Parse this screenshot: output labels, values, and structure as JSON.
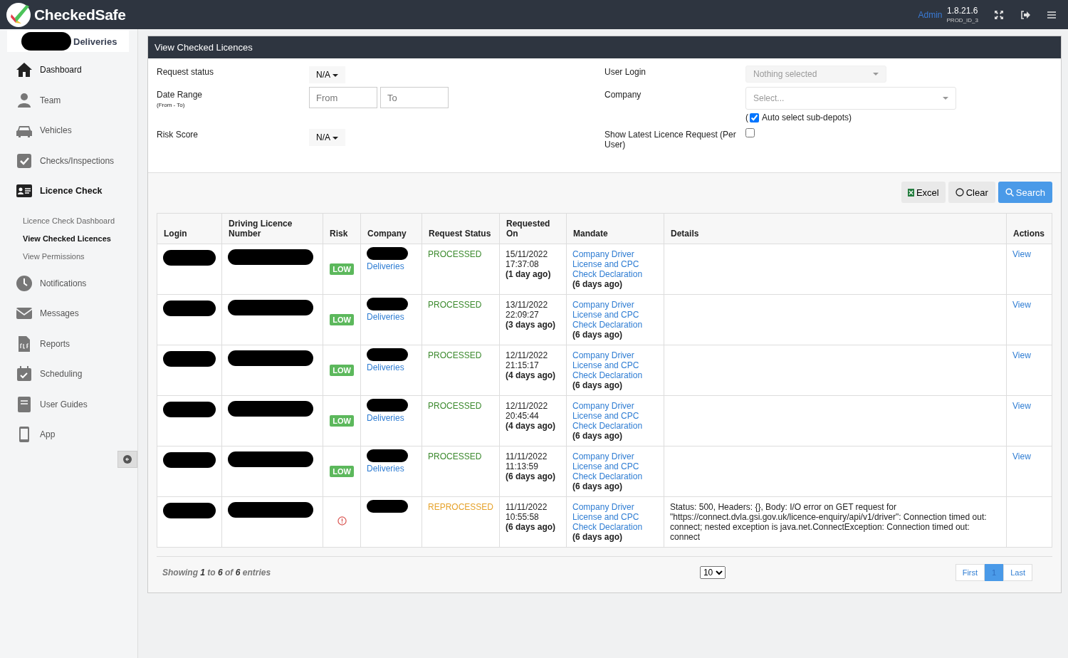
{
  "header": {
    "brand": "CheckedSafe",
    "role": "Admin",
    "version": "1.8.21.6",
    "env": "PROD_ID_3"
  },
  "sidebar": {
    "company": "Deliveries",
    "items": [
      {
        "label": "Dashboard",
        "selected": false
      },
      {
        "label": "Team",
        "selected": false
      },
      {
        "label": "Vehicles",
        "selected": false
      },
      {
        "label": "Checks/Inspections",
        "selected": false
      },
      {
        "label": "Licence Check",
        "selected": true,
        "children": [
          {
            "label": "Licence Check Dashboard",
            "selected": false
          },
          {
            "label": "View Checked Licences",
            "selected": true
          },
          {
            "label": "View Permissions",
            "selected": false
          }
        ]
      },
      {
        "label": "Notifications",
        "selected": false
      },
      {
        "label": "Messages",
        "selected": false
      },
      {
        "label": "Reports",
        "selected": false
      },
      {
        "label": "Scheduling",
        "selected": false
      },
      {
        "label": "User Guides",
        "selected": false
      },
      {
        "label": "App",
        "selected": false
      }
    ]
  },
  "panel": {
    "title": "View Checked Licences",
    "filters": {
      "request_status": {
        "label": "Request status",
        "value": "N/A"
      },
      "date_range": {
        "label": "Date Range",
        "hint": "(From - To)",
        "from_placeholder": "From",
        "to_placeholder": "To"
      },
      "risk_score": {
        "label": "Risk Score",
        "value": "N/A"
      },
      "user_login": {
        "label": "User Login",
        "placeholder": "Nothing selected"
      },
      "company": {
        "label": "Company",
        "placeholder": "Select...",
        "paren": "(",
        "auto_select": {
          "label": "Auto select sub-depots)",
          "checked": true
        }
      },
      "show_latest": {
        "label": "Show Latest Licence Request (Per User)",
        "checked": false
      }
    },
    "buttons": [
      {
        "label": "Excel",
        "kind": "excel"
      },
      {
        "label": "Clear",
        "kind": "clear"
      },
      {
        "label": "Search",
        "kind": "search"
      }
    ],
    "table": {
      "columns": [
        "Login",
        "Driving Licence Number",
        "Risk",
        "Company",
        "Request Status",
        "Requested On",
        "Mandate",
        "Details",
        "Actions"
      ],
      "rows": [
        {
          "risk": {
            "kind": "badge",
            "label": "LOW"
          },
          "company": "Deliveries",
          "status": {
            "kind": "processed",
            "label": "PROCESSED"
          },
          "date": "15/11/2022",
          "time": "17:37:08",
          "ago": "(1 day ago)",
          "mandate": "Company Driver License and CPC Check Declaration",
          "mandate_ago": "(6 days ago)",
          "action": "View"
        },
        {
          "risk": {
            "kind": "badge",
            "label": "LOW"
          },
          "company": "Deliveries",
          "status": {
            "kind": "processed",
            "label": "PROCESSED"
          },
          "date": "13/11/2022",
          "time": "22:09:27",
          "ago": "(3 days ago)",
          "mandate": "Company Driver License and CPC Check Declaration",
          "mandate_ago": "(6 days ago)",
          "action": "View"
        },
        {
          "risk": {
            "kind": "badge",
            "label": "LOW"
          },
          "company": "Deliveries",
          "status": {
            "kind": "processed",
            "label": "PROCESSED"
          },
          "date": "12/11/2022",
          "time": "21:15:17",
          "ago": "(4 days ago)",
          "mandate": "Company Driver License and CPC Check Declaration",
          "mandate_ago": "(6 days ago)",
          "action": "View"
        },
        {
          "risk": {
            "kind": "badge",
            "label": "LOW"
          },
          "company": "Deliveries",
          "status": {
            "kind": "processed",
            "label": "PROCESSED"
          },
          "date": "12/11/2022",
          "time": "20:45:44",
          "ago": "(4 days ago)",
          "mandate": "Company Driver License and CPC Check Declaration",
          "mandate_ago": "(6 days ago)",
          "action": "View"
        },
        {
          "risk": {
            "kind": "badge",
            "label": "LOW"
          },
          "company": "Deliveries",
          "status": {
            "kind": "processed",
            "label": "PROCESSED"
          },
          "date": "11/11/2022",
          "time": "11:13:59",
          "ago": "(6 days ago)",
          "mandate": "Company Driver License and CPC Check Declaration",
          "mandate_ago": "(6 days ago)",
          "action": "View"
        },
        {
          "risk": {
            "kind": "error"
          },
          "status": {
            "kind": "reprocessed",
            "label": "REPROCESSED"
          },
          "date": "11/11/2022",
          "time": "10:55:58",
          "ago": "(6 days ago)",
          "mandate": "Company Driver License and CPC Check Declaration",
          "mandate_ago": "(6 days ago)",
          "details": "Status: 500, Headers: {}, Body: I/O error on GET request for \"https://connect.dvla.gsi.gov.uk/licence-enquiry/api/v1/driver\": Connection timed out: connect; nested exception is java.net.ConnectException: Connection timed out: connect"
        }
      ]
    },
    "footer": {
      "summary": "Showing **1** to **6** of **6** entries",
      "page_size": "10",
      "pages": [
        {
          "label": "First",
          "selected": false
        },
        {
          "label": "1",
          "selected": true
        },
        {
          "label": "Last",
          "selected": false
        }
      ]
    }
  }
}
